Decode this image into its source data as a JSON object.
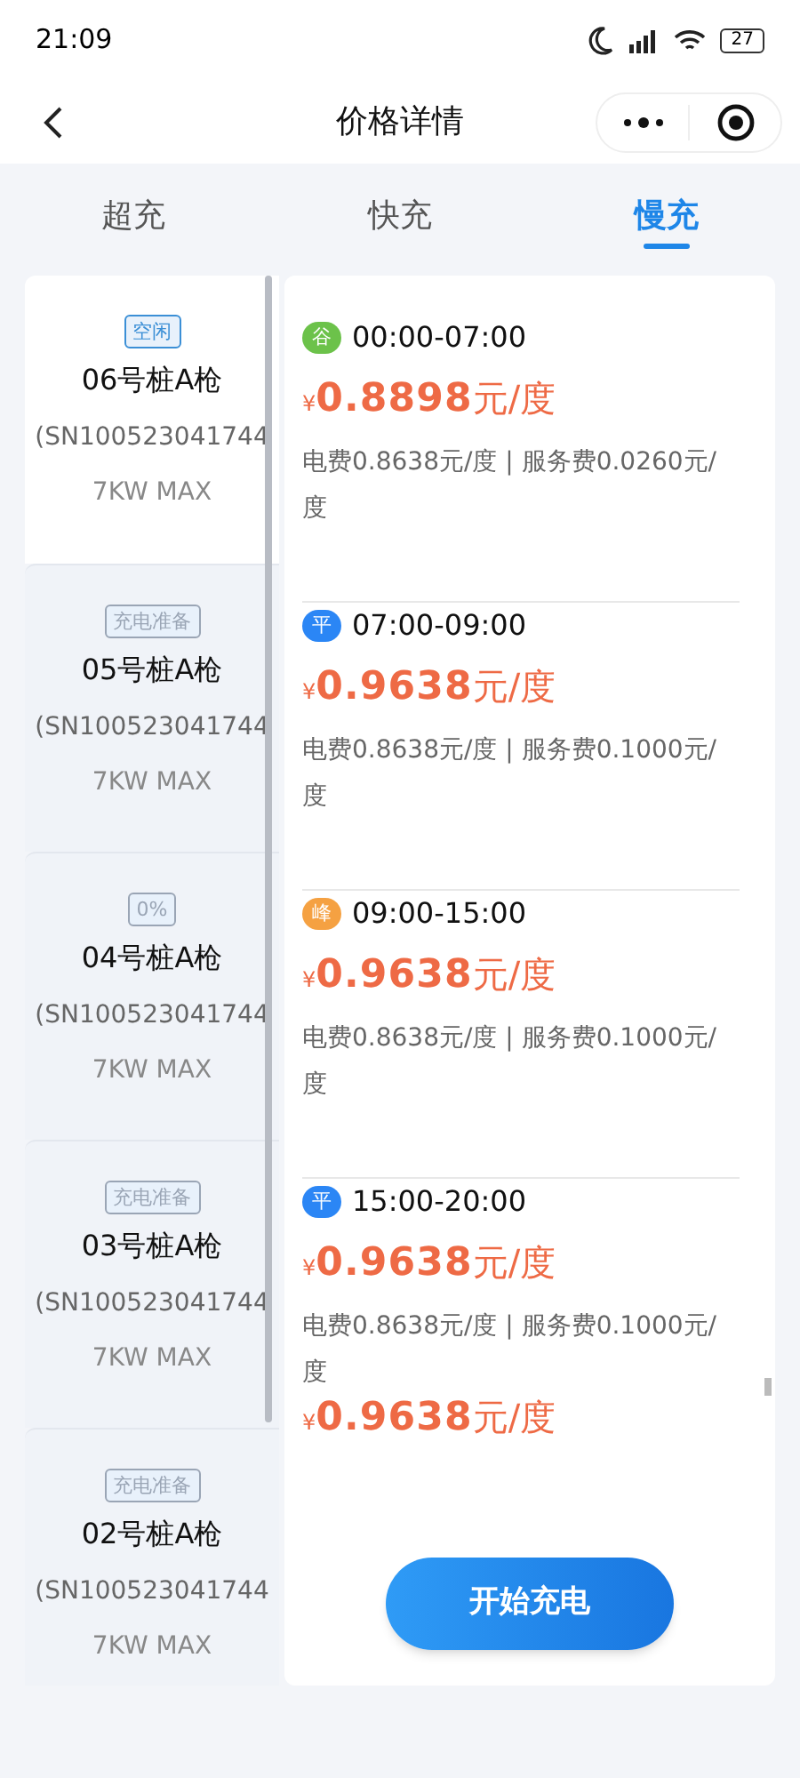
{
  "status_bar": {
    "time": "21:09",
    "battery": "27"
  },
  "nav": {
    "title": "价格详情"
  },
  "tabs": [
    {
      "label": "超充",
      "selected": false
    },
    {
      "label": "快充",
      "selected": false
    },
    {
      "label": "慢充",
      "selected": true
    }
  ],
  "piles": [
    {
      "tag": "空闲",
      "color": "#3b8fd6",
      "name": "06号桩A枪",
      "sn": "(SN100523041744",
      "power": "7KW MAX",
      "selected": true
    },
    {
      "tag": "充电准备",
      "color": "#9aa5b5",
      "name": "05号桩A枪",
      "sn": "(SN100523041744",
      "power": "7KW MAX",
      "selected": false
    },
    {
      "tag": "0%",
      "color": "#9aa5b5",
      "name": "04号桩A枪",
      "sn": "(SN100523041744",
      "power": "7KW MAX",
      "selected": false
    },
    {
      "tag": "充电准备",
      "color": "#9aa5b5",
      "name": "03号桩A枪",
      "sn": "(SN100523041744",
      "power": "7KW MAX",
      "selected": false
    },
    {
      "tag": "充电准备",
      "color": "#9aa5b5",
      "name": "02号桩A枪",
      "sn": "(SN100523041744",
      "power": "7KW MAX",
      "selected": false
    }
  ],
  "prices": [
    {
      "period": "谷",
      "color": "#6cc24a",
      "time": "00:00-07:00",
      "currency": "¥",
      "price": "0.8898",
      "unit": "元/度",
      "detail": "电费0.8638元/度 | 服务费0.0260元/度"
    },
    {
      "period": "平",
      "color": "#2b86f5",
      "time": "07:00-09:00",
      "currency": "¥",
      "price": "0.9638",
      "unit": "元/度",
      "detail": "电费0.8638元/度 | 服务费0.1000元/度"
    },
    {
      "period": "峰",
      "color": "#f5a142",
      "time": "09:00-15:00",
      "currency": "¥",
      "price": "0.9638",
      "unit": "元/度",
      "detail": "电费0.8638元/度 | 服务费0.1000元/度"
    },
    {
      "period": "平",
      "color": "#2b86f5",
      "time": "15:00-20:00",
      "currency": "¥",
      "price": "0.9638",
      "unit": "元/度",
      "detail": "电费0.8638元/度 | 服务费0.1000元/度"
    },
    {
      "currency": "¥",
      "price": "0.9638",
      "unit": "元/度"
    }
  ],
  "start_button": "开始充电"
}
